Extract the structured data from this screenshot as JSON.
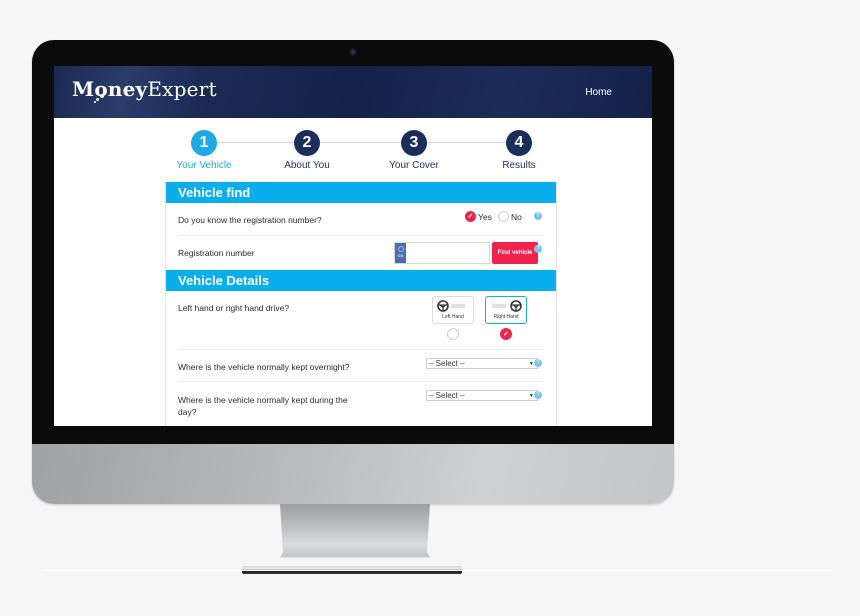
{
  "header": {
    "logo_part1": "Money",
    "logo_part2": "Expert",
    "nav_home": "Home"
  },
  "steps": [
    {
      "number": "1",
      "label": "Your Vehicle",
      "active": true
    },
    {
      "number": "2",
      "label": "About You",
      "active": false
    },
    {
      "number": "3",
      "label": "Your Cover",
      "active": false
    },
    {
      "number": "4",
      "label": "Results",
      "active": false
    }
  ],
  "vehicle_find": {
    "title": "Vehicle find",
    "know_reg": {
      "question": "Do you know the registration number?",
      "options": [
        "Yes",
        "No"
      ],
      "selected": "Yes"
    },
    "reg_number": {
      "label": "Registration number",
      "plate_country": "GB",
      "value": "",
      "button": "Find vehicle"
    }
  },
  "vehicle_details": {
    "title": "Vehicle Details",
    "drive_side": {
      "question": "Left hand or right hand drive?",
      "options": [
        "Left Hand",
        "Right Hand"
      ],
      "selected": "Right Hand"
    },
    "kept_overnight": {
      "question": "Where is the vehicle normally kept overnight?",
      "value": "– Select –"
    },
    "kept_day": {
      "question": "Where is the vehicle normally kept during the day?",
      "value": "– Select –"
    }
  },
  "help_glyph": "?",
  "check_glyph": "✓",
  "caret_glyph": "▼",
  "colors": {
    "accent_blue": "#0aaeea",
    "step_active": "#1ea8e6",
    "step_inactive": "#1b2e5a",
    "cta_red": "#f0234f",
    "header_navy": "#13224a"
  }
}
